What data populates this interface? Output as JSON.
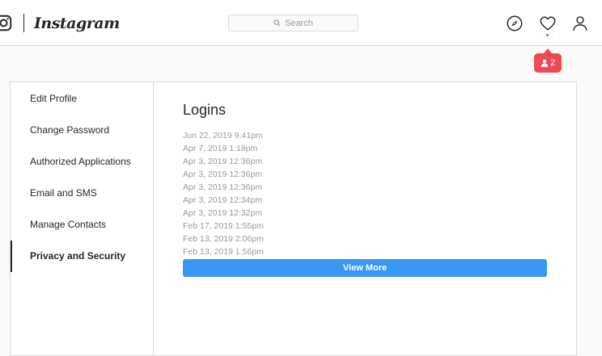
{
  "header": {
    "brand": "Instagram",
    "search": {
      "placeholder": "Search"
    },
    "icons": [
      "instagram-logo-icon",
      "compass-icon",
      "heart-icon",
      "profile-icon"
    ],
    "notification": {
      "count": "2",
      "icon": "person-icon"
    }
  },
  "sidebar": {
    "items": [
      {
        "label": "Edit Profile",
        "active": false
      },
      {
        "label": "Change Password",
        "active": false
      },
      {
        "label": "Authorized Applications",
        "active": false
      },
      {
        "label": "Email and SMS",
        "active": false
      },
      {
        "label": "Manage Contacts",
        "active": false
      },
      {
        "label": "Privacy and Security",
        "active": true
      }
    ]
  },
  "main": {
    "title": "Logins",
    "logins": [
      "Jun 22, 2019 9:41pm",
      "Apr 7, 2019 1:18pm",
      "Apr 3, 2019 12:36pm",
      "Apr 3, 2019 12:36pm",
      "Apr 3, 2019 12:36pm",
      "Apr 3, 2019 12:34pm",
      "Apr 3, 2019 12:32pm",
      "Feb 17, 2019 1:55pm",
      "Feb 13, 2019 2:06pm",
      "Feb 13, 2019 1:56pm"
    ],
    "view_more_label": "View More"
  },
  "colors": {
    "accent": "#3897f0",
    "notification": "#ed4956",
    "text": "#262626",
    "muted": "#999999",
    "border": "#dbdbdb"
  }
}
